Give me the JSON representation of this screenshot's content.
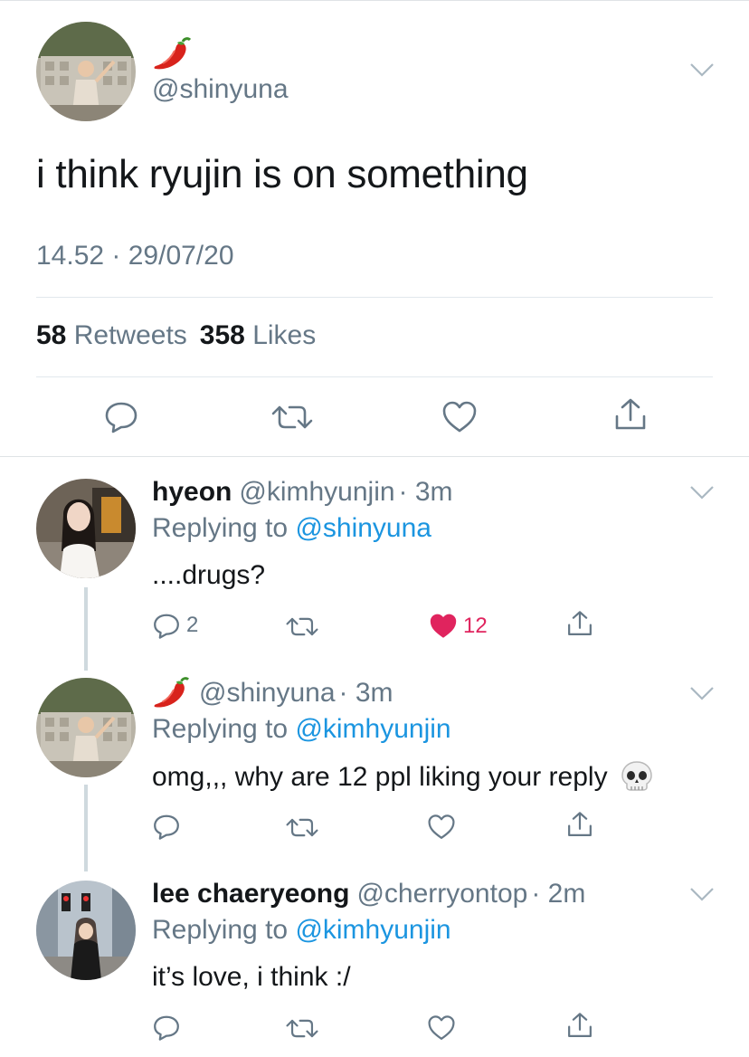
{
  "main_tweet": {
    "display_name_emoji": "chili-pepper-emoji",
    "handle": "@shinyuna",
    "text": "i think ryujin is on something",
    "timestamp": "14.52 · 29/07/20",
    "retweets_count": "58",
    "retweets_label": "Retweets",
    "likes_count": "358",
    "likes_label": "Likes",
    "actions": [
      "reply-icon",
      "retweet-icon",
      "like-icon",
      "share-icon"
    ]
  },
  "replies": [
    {
      "name": "hyeon",
      "handle": "@kimhyunjin",
      "time": "· 3m",
      "replying_prefix": "Replying to",
      "replying_to": "@shinyuna",
      "text": "....drugs?",
      "reply_count": "2",
      "like_count": "12",
      "liked": true
    },
    {
      "name_emoji": "chili-pepper-emoji",
      "handle": "@shinyuna",
      "time": "· 3m",
      "replying_prefix": "Replying to",
      "replying_to": "@kimhyunjin",
      "text": "omg,,, why are 12 ppl liking your reply",
      "text_emoji": "skull-emoji"
    },
    {
      "name": "lee chaeryeong",
      "handle": "@cherryontop",
      "time": "· 2m",
      "replying_prefix": "Replying to",
      "replying_to": "@kimhyunjin",
      "text": "it’s love, i think :/"
    }
  ],
  "colors": {
    "text": "#14171a",
    "secondary": "#657786",
    "link": "#1b95e0",
    "like_active": "#e0245e",
    "divider": "#e1e8ed",
    "thread_line": "#cfd9de"
  }
}
